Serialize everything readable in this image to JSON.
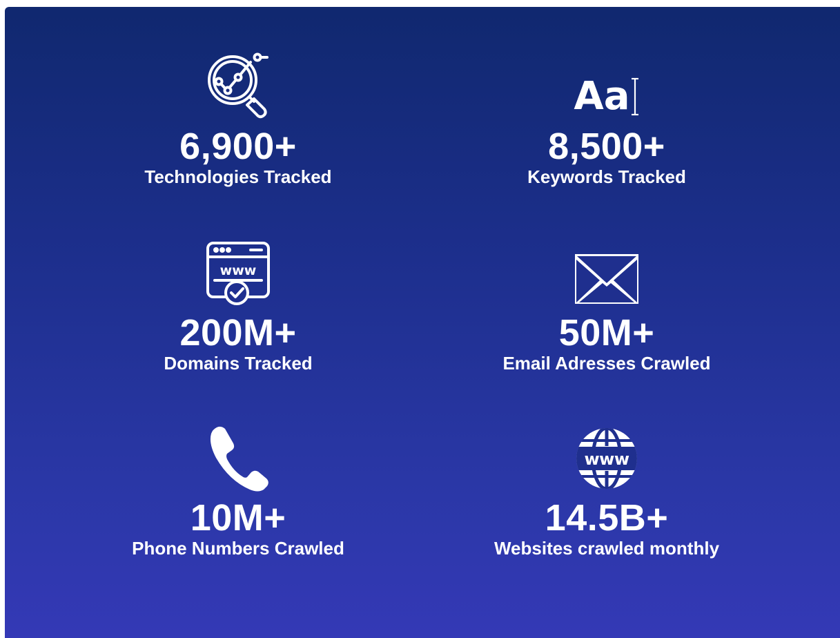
{
  "colors": {
    "gradient_top": "#10286f",
    "gradient_bottom": "#3439b6",
    "text": "#ffffff"
  },
  "stats": [
    {
      "icon": "magnifier-chart-icon",
      "value": "6,900+",
      "label": "Technologies Tracked"
    },
    {
      "icon": "text-font-icon",
      "icon_text": "Aa",
      "value": "8,500+",
      "label": "Keywords Tracked"
    },
    {
      "icon": "browser-www-check-icon",
      "icon_text": "www",
      "value": "200M+",
      "label": "Domains Tracked"
    },
    {
      "icon": "envelope-icon",
      "value": "50M+",
      "label": "Email Adresses Crawled"
    },
    {
      "icon": "phone-icon",
      "value": "10M+",
      "label": "Phone Numbers Crawled"
    },
    {
      "icon": "globe-www-icon",
      "icon_text": "www",
      "value": "14.5B+",
      "label": "Websites crawled monthly"
    }
  ]
}
